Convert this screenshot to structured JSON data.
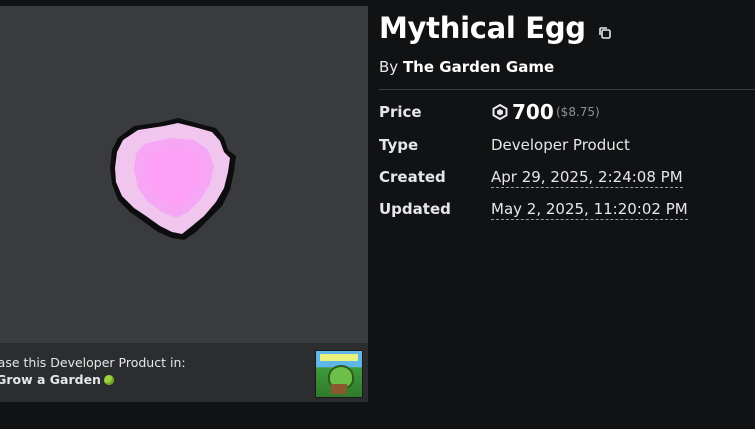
{
  "thumbnail": {
    "purchase_prompt": "rchase this Developer Product in:",
    "game_name": "Grow a Garden"
  },
  "product": {
    "title": "Mythical Egg",
    "by_prefix": "By",
    "creator": "The Garden Game"
  },
  "details": {
    "price_label": "Price",
    "price_robux": "700",
    "price_usd": "($8.75)",
    "type_label": "Type",
    "type_value": "Developer Product",
    "created_label": "Created",
    "created_value": "Apr 29, 2025, 2:24:08 PM",
    "updated_label": "Updated",
    "updated_value": "May 2, 2025, 11:20:02 PM"
  },
  "colors": {
    "page_background": "#111214",
    "thumbnail_background": "#393b3d",
    "egg_pink": "#f7a6f5"
  }
}
